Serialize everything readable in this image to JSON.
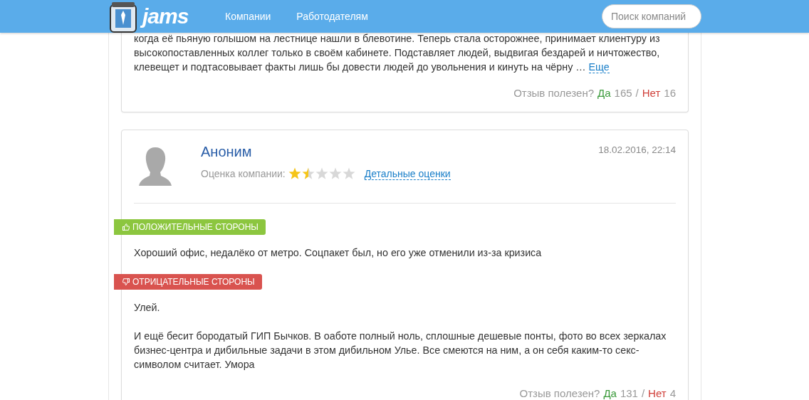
{
  "header": {
    "logo": "jams",
    "nav": [
      {
        "label": "Компании"
      },
      {
        "label": "Работодателям"
      }
    ],
    "search": {
      "placeholder": "Поиск компаний"
    }
  },
  "reviews": [
    {
      "text": "когда её пьяную голышом на лестнице нашли в блевотине. Теперь стала осторожнее, принимает клиентуру из\nвысокопоставленных коллег только в своём кабинете. Подставляет людей, выдвигая бездарей и ничтожество,\nклевещет и подтасовывает факты лишь бы довести людей до увольнения и кинуть на чёрну …",
      "more": "Еще",
      "helpful": {
        "question": "Отзыв полезен?",
        "yes": "Да",
        "yes_count": "165",
        "sep": "/",
        "no": "Нет",
        "no_count": "16"
      }
    },
    {
      "author": "Аноним",
      "date": "18.02.2016, 22:14",
      "rating_label": "Оценка компании:",
      "stars": 1.5,
      "details_link": "Детальные оценки",
      "sections": [
        {
          "kind": "positive",
          "title": "ПОЛОЖИТЕЛЬНЫЕ СТОРОНЫ",
          "paragraphs": [
            "Хороший офис, недалёко от метро. Соцпакет был, но его уже отменили из-за кризиса"
          ]
        },
        {
          "kind": "negative",
          "title": "ОТРИЦАТЕЛЬНЫЕ СТОРОНЫ",
          "paragraphs": [
            "Улей.",
            "И ещё бесит бородатый ГИП Бычков. В оаботе полный ноль, сплошные дешевые понты, фото во всех зеркалах бизнес-центра и дибильные задачи в этом дибильном Улье. Все смеются на ним, а он себя каким-то секс-символом считает. Умора"
          ]
        }
      ],
      "helpful": {
        "question": "Отзыв полезен?",
        "yes": "Да",
        "yes_count": "131",
        "sep": "/",
        "no": "Нет",
        "no_count": "4"
      }
    }
  ]
}
